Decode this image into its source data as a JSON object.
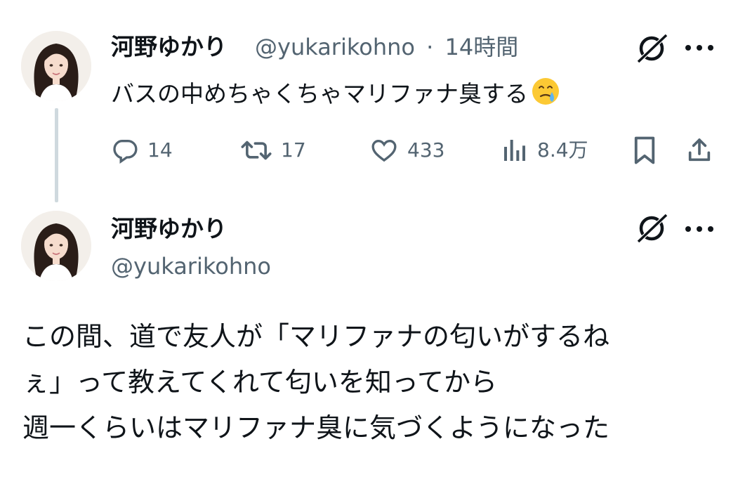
{
  "tweet1": {
    "display_name": "河野ゆかり",
    "handle": "@yukarikohno",
    "separator": "·",
    "time": "14時間",
    "text": "バスの中めちゃくちゃマリファナ臭する",
    "emoji_icon": "face-holding-back-tears-icon",
    "actions": {
      "replies": "14",
      "retweets": "17",
      "likes": "433",
      "views": "8.4万"
    }
  },
  "tweet2": {
    "display_name": "河野ゆかり",
    "handle": "@yukarikohno",
    "body_lines": [
      "この間、道で友人が「マリファナの匂いがするね",
      "ぇ」って教えてくれて匂いを知ってから",
      "週一くらいはマリファナ臭に気づくようになった"
    ]
  },
  "colors": {
    "text_primary": "#0f1419",
    "text_secondary": "#536471",
    "thread_line": "#cfd9de",
    "grok_icon": "#0f1419"
  }
}
